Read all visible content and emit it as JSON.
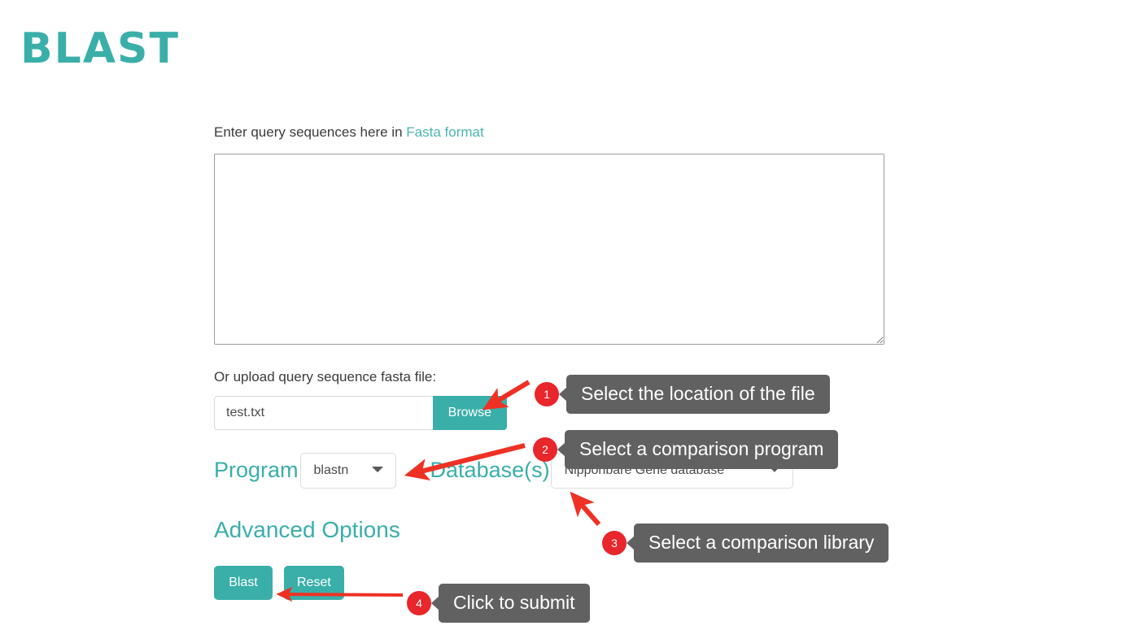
{
  "brand": {
    "logo_text": "BLAST"
  },
  "form": {
    "query_label_prefix": "Enter query sequences here in",
    "fasta_link_label": "Fasta format",
    "query_textarea_value": "",
    "query_textarea_placeholder": "",
    "upload_label": "Or upload query sequence fasta file:",
    "file_name_value": "test.txt",
    "file_name_placeholder": "",
    "browse_label": "Browse",
    "program_label": "Program",
    "program_selected": "blastn",
    "program_options": [
      "blastn"
    ],
    "database_label": "Database(s)",
    "database_selected": "Nipponbare Gene database",
    "database_options": [
      "Nipponbare Gene database"
    ],
    "advanced_options_label": "Advanced Options",
    "submit_label": "Blast",
    "reset_label": "Reset"
  },
  "annotations": [
    {
      "number": "1",
      "text": "Select the location of the file"
    },
    {
      "number": "2",
      "text": "Select a comparison program"
    },
    {
      "number": "3",
      "text": "Select a comparison library"
    },
    {
      "number": "4",
      "text": "Click to submit"
    }
  ],
  "colors": {
    "accent_teal": "#3aafa9",
    "link_teal": "#4bb5b0",
    "callout_red": "#e8262b",
    "callout_gray": "#616161",
    "arrow_red": "#ee3124",
    "page_background": "#ffffff"
  }
}
